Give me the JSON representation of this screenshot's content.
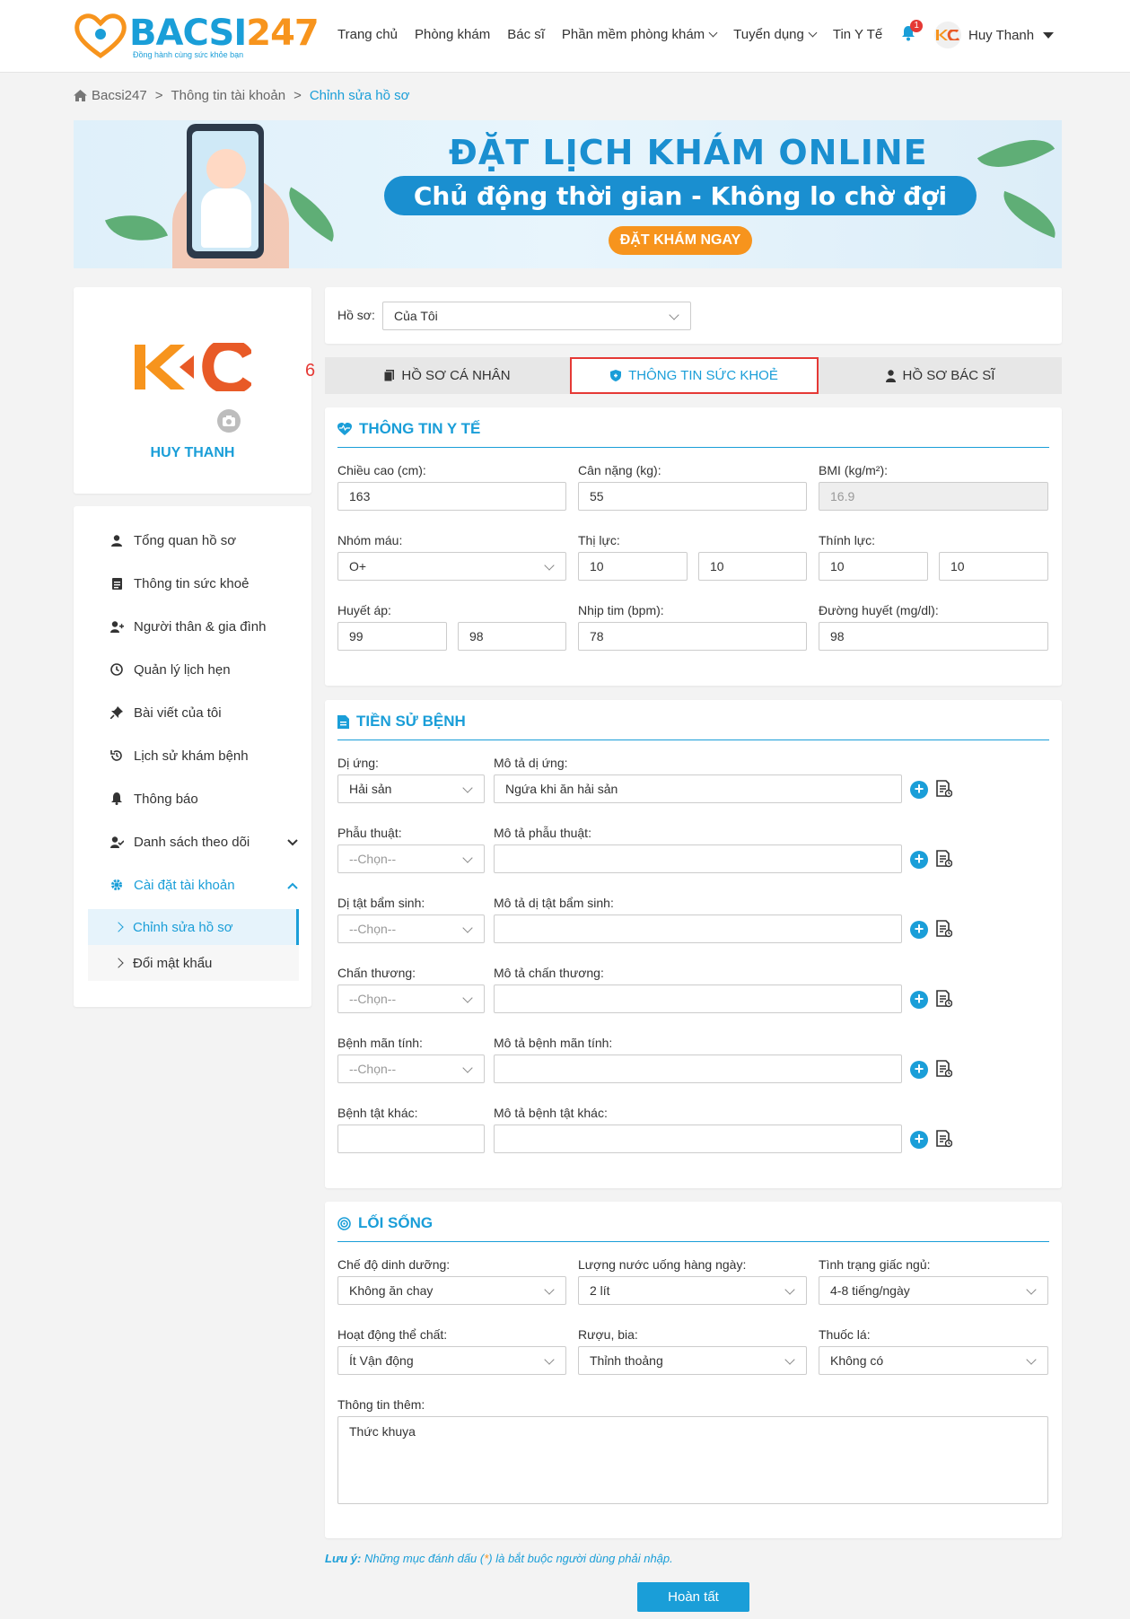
{
  "header": {
    "logo_text": "BACSI",
    "logo_num": "247",
    "logo_slogan": "Đồng hành cùng sức khỏe bạn",
    "nav": [
      {
        "label": "Trang chủ"
      },
      {
        "label": "Phòng khám"
      },
      {
        "label": "Bác sĩ"
      },
      {
        "label": "Phần mềm phòng khám"
      },
      {
        "label": "Tuyển dụng"
      },
      {
        "label": "Tin Y Tế"
      }
    ],
    "notification_count": "1",
    "user_name": "Huy Thanh"
  },
  "breadcrumb": [
    "Bacsi247",
    "Thông tin tài khoản",
    "Chỉnh sửa hồ sơ"
  ],
  "banner": {
    "title": "ĐẶT LỊCH KHÁM ONLINE",
    "subtitle": "Chủ động thời gian - Không lo chờ đợi",
    "button": "ĐẶT KHÁM NGAY"
  },
  "profile": {
    "name": "HUY THANH"
  },
  "menu": [
    "Tổng quan hồ sơ",
    "Thông tin sức khoẻ",
    "Người thân & gia đình",
    "Quản lý lịch hẹn",
    "Bài viết của tôi",
    "Lịch sử khám bệnh",
    "Thông báo",
    "Danh sách theo dõi",
    "Cài đặt tài khoản"
  ],
  "submenu": [
    "Chỉnh sửa hồ sơ",
    "Đổi mật khẩu"
  ],
  "profile_select": {
    "label": "Hồ sơ:",
    "value": "Của Tôi"
  },
  "tabs": [
    "HỒ SƠ CÁ NHÂN",
    "THÔNG TIN SỨC KHOẺ",
    "HỒ SƠ BÁC SĨ"
  ],
  "tab_annotation": "6",
  "medical": {
    "title": "THÔNG TIN Y TẾ",
    "height_label": "Chiều cao (cm):",
    "height": "163",
    "weight_label": "Cân nặng (kg):",
    "weight": "55",
    "bmi_label": "BMI (kg/m²):",
    "bmi": "16.9",
    "blood_label": "Nhóm máu:",
    "blood": "O+",
    "vision_label": "Thị lực:",
    "vision_left": "10",
    "vision_right": "10",
    "hearing_label": "Thính lực:",
    "hearing_left": "10",
    "hearing_right": "10",
    "bp_label": "Huyết áp:",
    "bp_high": "99",
    "bp_low": "98",
    "hr_label": "Nhịp tim (bpm):",
    "hr": "78",
    "glucose_label": "Đường huyết (mg/dl):",
    "glucose": "98"
  },
  "history": {
    "title": "TIỀN SỬ BỆNH",
    "rows": [
      {
        "label": "Dị ứng:",
        "value": "Hải sản",
        "desc_label": "Mô tả dị ứng:",
        "desc": "Ngứa khi ăn hải sản"
      },
      {
        "label": "Phẫu thuật:",
        "value": "--Chọn--",
        "desc_label": "Mô tả phẫu thuật:",
        "desc": ""
      },
      {
        "label": "Dị tật bẩm sinh:",
        "value": "--Chọn--",
        "desc_label": "Mô tả dị tật bẩm sinh:",
        "desc": ""
      },
      {
        "label": "Chấn thương:",
        "value": "--Chọn--",
        "desc_label": "Mô tả chấn thương:",
        "desc": ""
      },
      {
        "label": "Bệnh mãn tính:",
        "value": "--Chọn--",
        "desc_label": "Mô tả bệnh mãn tính:",
        "desc": ""
      },
      {
        "label": "Bệnh tật khác:",
        "value": "",
        "desc_label": "Mô tả bệnh tật khác:",
        "desc": ""
      }
    ]
  },
  "lifestyle": {
    "title": "LỐI SỐNG",
    "diet_label": "Chế độ dinh dưỡng:",
    "diet": "Không ăn chay",
    "water_label": "Lượng nước uống hàng ngày:",
    "water": "2 lít",
    "sleep_label": "Tình trạng giấc ngủ:",
    "sleep": "4-8 tiếng/ngày",
    "activity_label": "Hoạt động thể chất:",
    "activity": "Ít Vận động",
    "alcohol_label": "Rượu, bia:",
    "alcohol": "Thỉnh thoảng",
    "smoking_label": "Thuốc lá:",
    "smoking": "Không có",
    "extra_label": "Thông tin thêm:",
    "extra": "Thức khuya"
  },
  "note": {
    "prefix": "Lưu ý:",
    "text1": " Những mục đánh dấu (",
    "star": "*",
    "text2": ") là bắt buộc người dùng phải nhập."
  },
  "submit_label": "Hoàn tất",
  "colors": {
    "primary": "#1a9ed8",
    "accent": "#f7941d",
    "highlight": "#e53935"
  }
}
